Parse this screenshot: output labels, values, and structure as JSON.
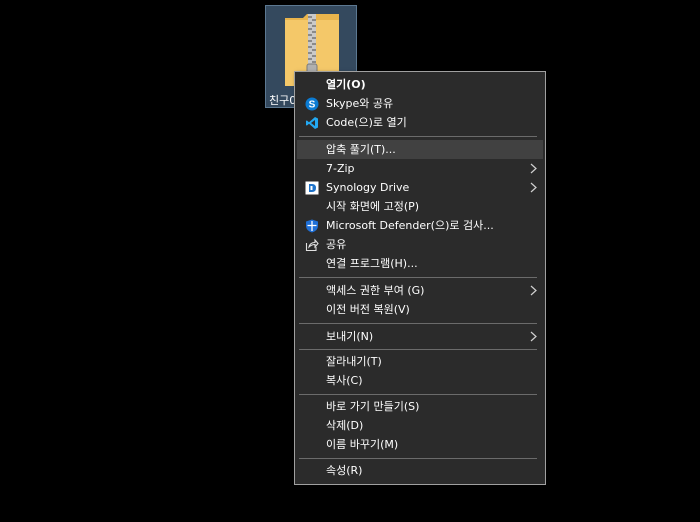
{
  "desktop": {
    "file_caption": "친구0"
  },
  "menu": {
    "items": [
      {
        "label": "열기(O)"
      },
      {
        "label": "Skype와 공유"
      },
      {
        "label": "Code(으)로 열기"
      },
      {
        "label": "압축 풀기(T)..."
      },
      {
        "label": "7-Zip"
      },
      {
        "label": "Synology Drive"
      },
      {
        "label": "시작 화면에 고정(P)"
      },
      {
        "label": "Microsoft Defender(으)로 검사..."
      },
      {
        "label": "공유"
      },
      {
        "label": "연결 프로그램(H)..."
      },
      {
        "label": "액세스 권한 부여 (G)"
      },
      {
        "label": "이전 버전 복원(V)"
      },
      {
        "label": "보내기(N)"
      },
      {
        "label": "잘라내기(T)"
      },
      {
        "label": "복사(C)"
      },
      {
        "label": "바로 가기 만들기(S)"
      },
      {
        "label": "삭제(D)"
      },
      {
        "label": "이름 바꾸기(M)"
      },
      {
        "label": "속성(R)"
      }
    ]
  },
  "colors": {
    "menu_bg": "#2b2b2b",
    "hover_bg": "#414141",
    "skype_blue": "#0b7bd3",
    "vscode_blue": "#23a9f2",
    "defender_blue": "#1f6fd6",
    "folder_yellow": "#f4c869"
  }
}
